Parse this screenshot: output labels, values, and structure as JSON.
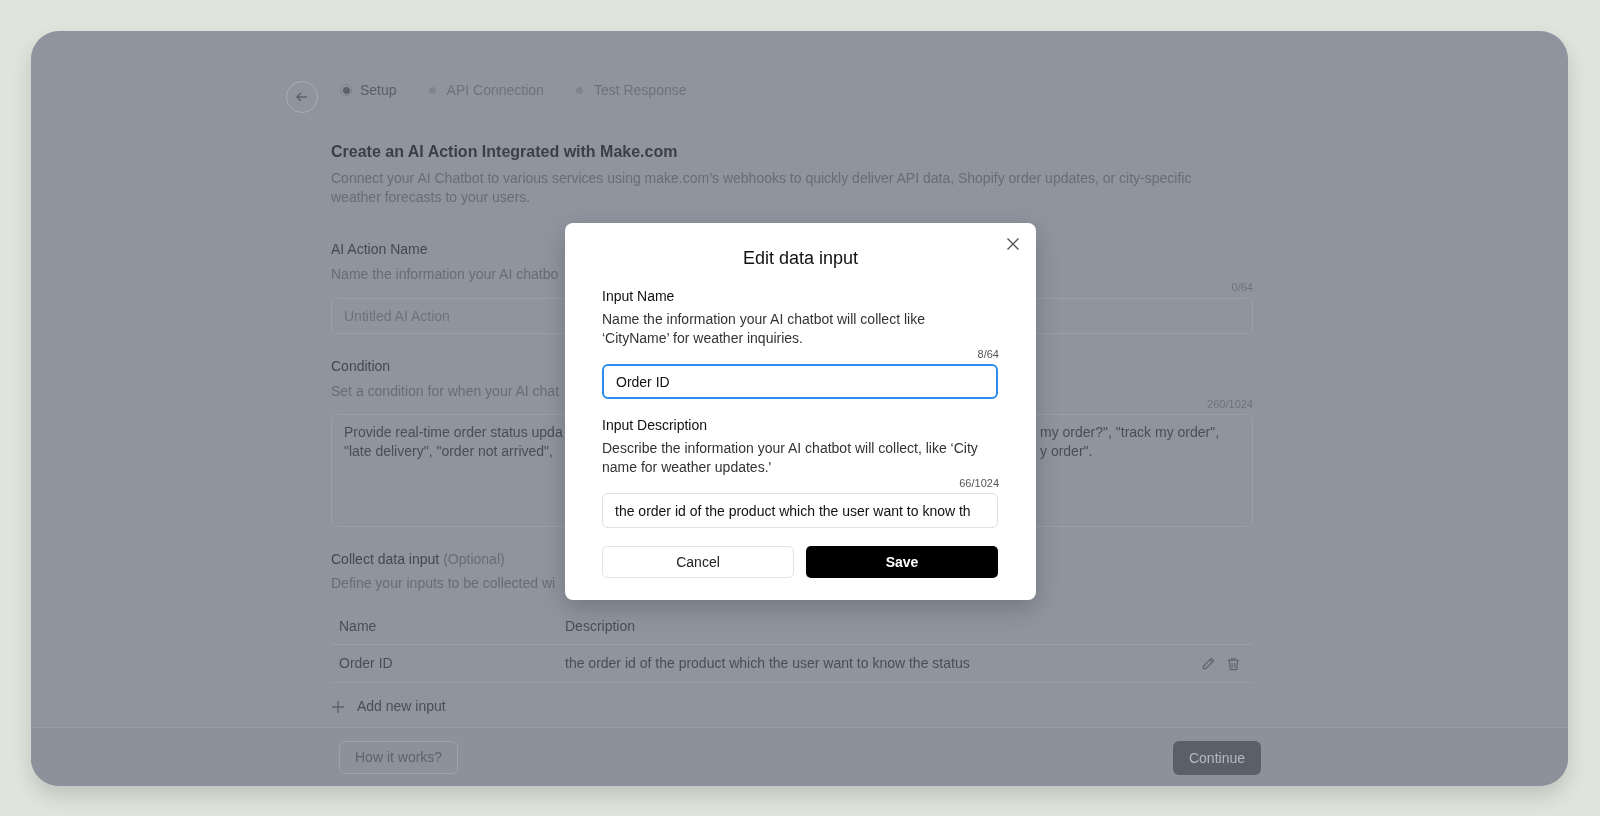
{
  "steps": [
    {
      "label": "Setup",
      "selected": true
    },
    {
      "label": "API Connection",
      "selected": false
    },
    {
      "label": "Test Response",
      "selected": false
    }
  ],
  "page": {
    "title": "Create an AI Action Integrated with Make.com",
    "description": "Connect your AI Chatbot to various services using make.com’s webhooks to quickly deliver API data, Shopify order updates, or city-specific weather forecasts to your users."
  },
  "action_name": {
    "label": "AI Action Name",
    "hint": "Name the information your AI chatbo",
    "counter": "0/64",
    "placeholder": "Untitled AI Action"
  },
  "condition": {
    "label": "Condition",
    "hint": "Set a condition for when your AI chat",
    "counter": "260/1024",
    "value_left": [
      "Provide real-time order status upda",
      "\"late delivery\", \"order not arrived\","
    ],
    "value_right": [
      "my order?\", \"track my order\",",
      "y order\"."
    ]
  },
  "collect": {
    "label": "Collect data input",
    "optional": "(Optional)",
    "hint": "Define your inputs to be collected wi",
    "columns": [
      "Name",
      "Description"
    ],
    "rows": [
      {
        "name": "Order ID",
        "description": "the order id of the product which the user want to know the status"
      }
    ],
    "add_label": "Add new input"
  },
  "footer": {
    "help_button": "How it works?",
    "continue_button": "Continue"
  },
  "modal": {
    "title": "Edit data input",
    "name_field": {
      "label": "Input Name",
      "hint": "Name the information your AI chatbot will collect like ‘CityName’ for weather inquiries.",
      "counter": "8/64",
      "value": "Order ID",
      "focused": true
    },
    "description_field": {
      "label": "Input Description",
      "hint": "Describe the information your AI chatbot will collect, like ‘City name for weather updates.'",
      "counter": "66/1024",
      "value": "the order id of the product which the user want to know th",
      "focused": false
    },
    "cancel_button": "Cancel",
    "save_button": "Save"
  }
}
